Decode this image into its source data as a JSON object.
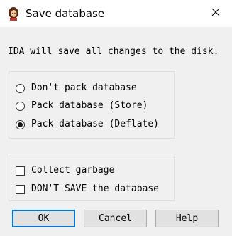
{
  "window": {
    "title": "Save database",
    "app_icon": "ida-logo-icon",
    "close_icon": "close-icon"
  },
  "message": "IDA will save all changes to the disk.",
  "pack_options": [
    {
      "label": "Don't pack database",
      "checked": false
    },
    {
      "label": "Pack database (Store)",
      "checked": false
    },
    {
      "label": "Pack database (Deflate)",
      "checked": true
    }
  ],
  "extra_options": [
    {
      "label": "Collect garbage",
      "checked": false
    },
    {
      "label": "DON'T SAVE the database",
      "checked": false
    }
  ],
  "buttons": {
    "ok": "OK",
    "cancel": "Cancel",
    "help": "Help"
  },
  "colors": {
    "focus_border": "#0078d7",
    "dialog_bg": "#f0f0f0",
    "titlebar_bg": "#ffffff"
  }
}
